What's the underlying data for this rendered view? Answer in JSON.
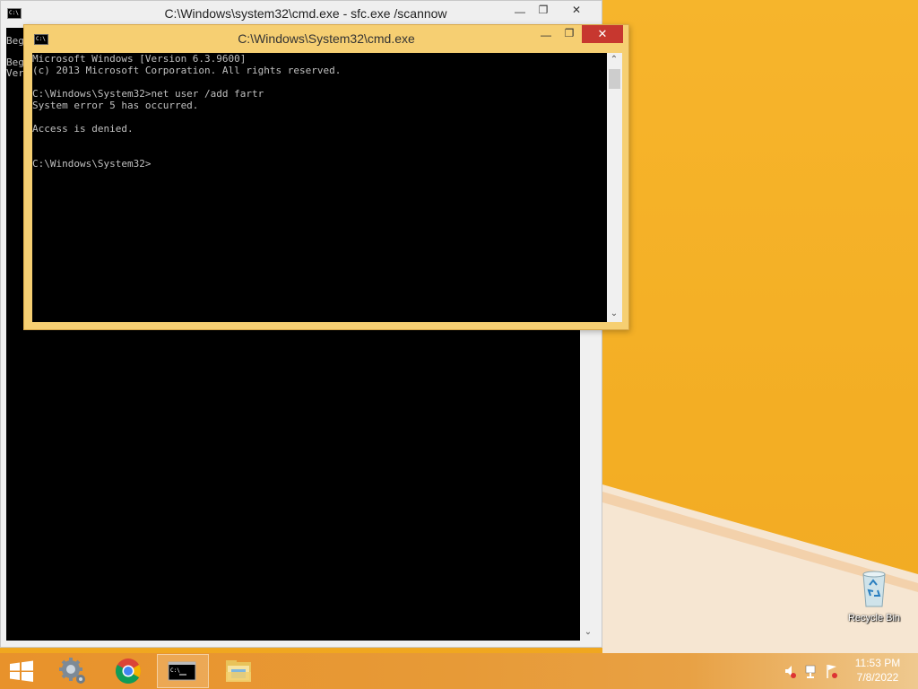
{
  "back_window": {
    "title": "C:\\Windows\\system32\\cmd.exe - sfc.exe  /scannow",
    "console_lines": [
      "Beg",
      "",
      "Beg",
      "Ver"
    ]
  },
  "front_window": {
    "title": "C:\\Windows\\System32\\cmd.exe",
    "console_lines": [
      "Microsoft Windows [Version 6.3.9600]",
      "(c) 2013 Microsoft Corporation. All rights reserved.",
      "",
      "C:\\Windows\\System32>net user /add fartr",
      "System error 5 has occurred.",
      "",
      "Access is denied.",
      "",
      "",
      "C:\\Windows\\System32>"
    ]
  },
  "caption_glyphs": {
    "minimize": "—",
    "maximize": "❐",
    "close": "✕"
  },
  "desktop": {
    "recycle_bin_label": "Recycle Bin"
  },
  "taskbar": {
    "items": [
      "settings-icon",
      "chrome-icon",
      "command-prompt-icon",
      "file-explorer-icon"
    ],
    "clock_time": "11:53 PM",
    "clock_date": "7/8/2022"
  }
}
